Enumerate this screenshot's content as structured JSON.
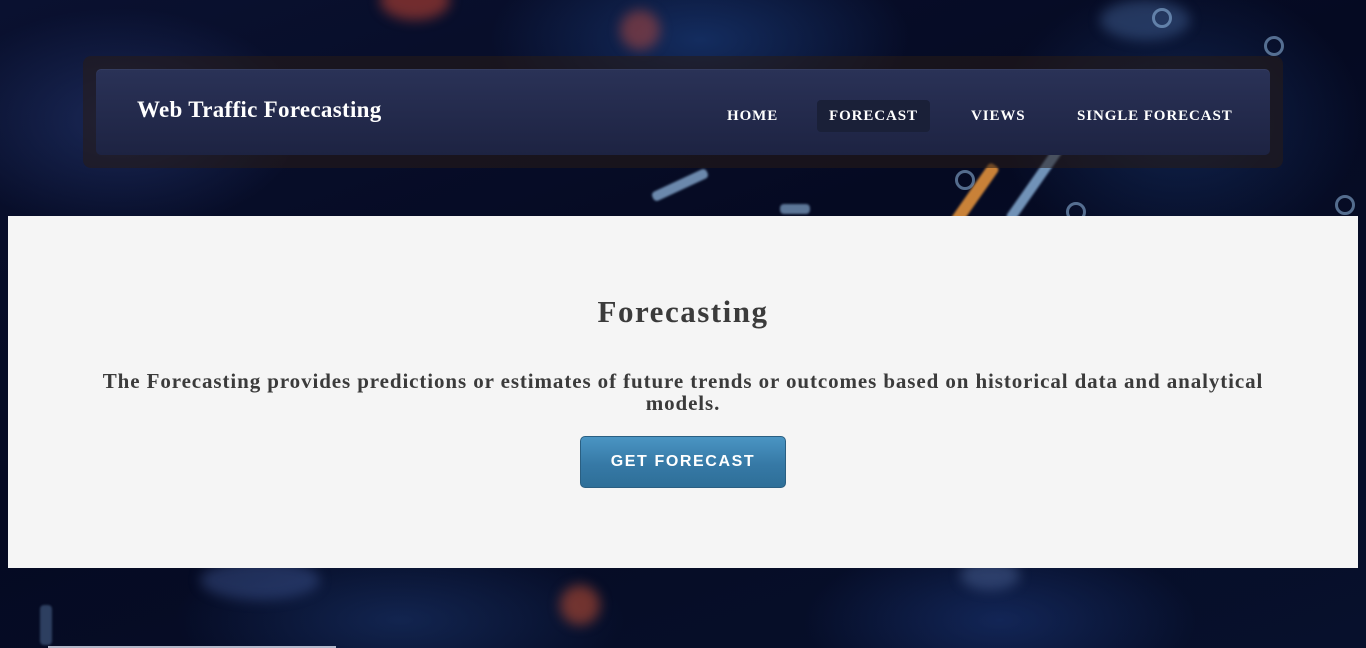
{
  "navbar": {
    "brand": "Web Traffic Forecasting",
    "links": [
      {
        "label": "HOME",
        "active": false
      },
      {
        "label": "FORECAST",
        "active": true
      },
      {
        "label": "VIEWS",
        "active": false
      },
      {
        "label": "SINGLE FORECAST",
        "active": false
      }
    ]
  },
  "main": {
    "title": "Forecasting",
    "description": "The Forecasting provides predictions or estimates of future trends or outcomes based on historical data and analytical models.",
    "button_label": "GET FORECAST"
  },
  "colors": {
    "navbar_bg": "#232a4c",
    "panel_bg": "#f5f5f5",
    "button_bg": "#3679a6",
    "text_dark": "#3b3b3b"
  }
}
